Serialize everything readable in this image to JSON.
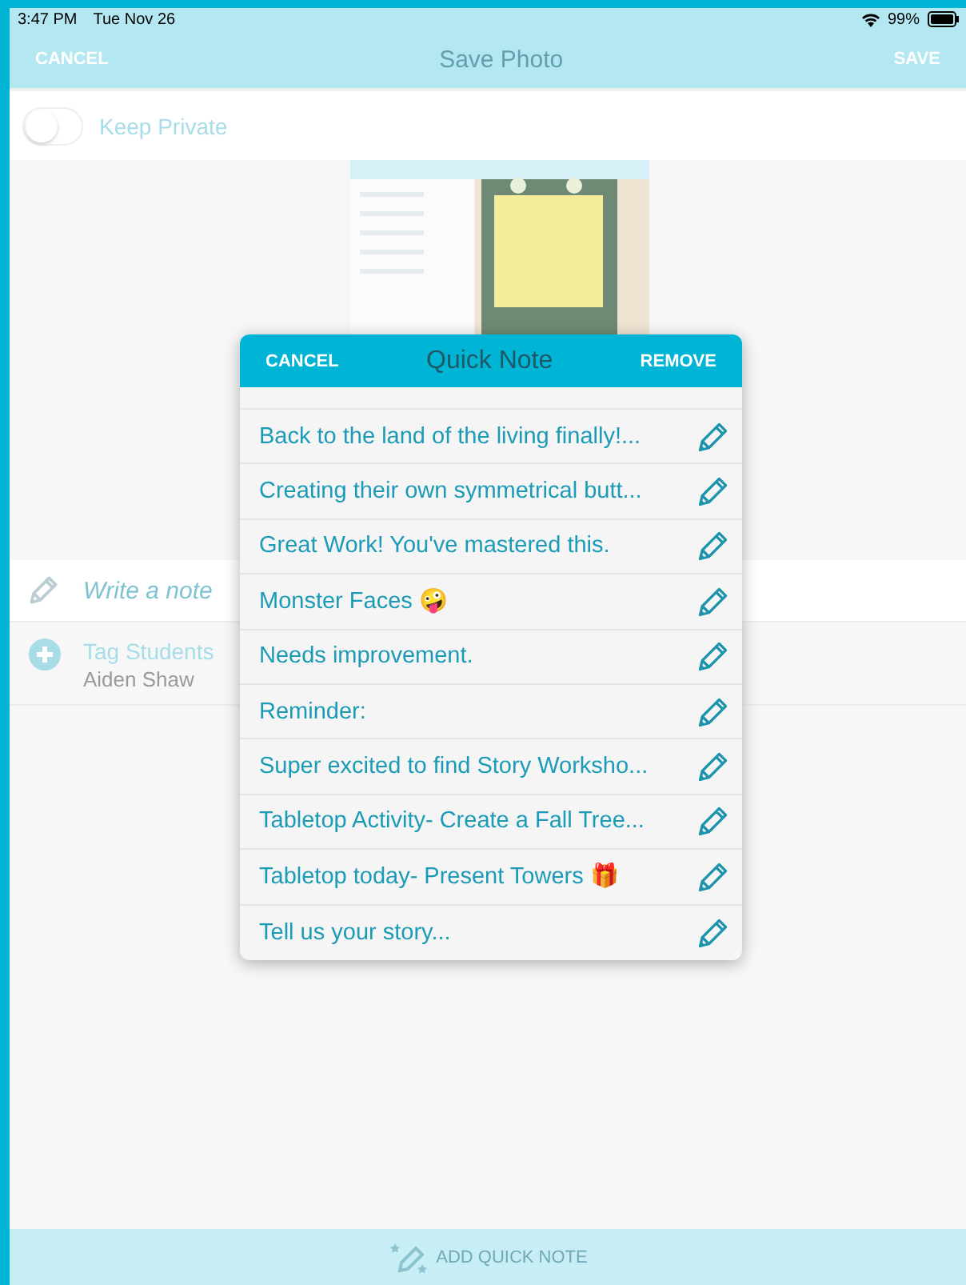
{
  "status_bar": {
    "time": "3:47 PM",
    "date": "Tue Nov 26",
    "battery": "99%"
  },
  "nav_bar": {
    "left": "CANCEL",
    "title": "Save Photo",
    "right": "SAVE"
  },
  "keep_private": {
    "label": "Keep Private",
    "on": false
  },
  "note_field": {
    "placeholder": "Write a note"
  },
  "tag_students": {
    "label": "Tag Students",
    "names": "Aiden Shaw"
  },
  "bottom_bar": {
    "label": "ADD QUICK NOTE"
  },
  "quick_note": {
    "title": "Quick Note",
    "cancel": "CANCEL",
    "remove": "REMOVE",
    "notes": [
      {
        "text": "Back to the land of the living finally!..."
      },
      {
        "text": "Creating their own symmetrical butt..."
      },
      {
        "text": "Great Work! You've mastered this."
      },
      {
        "text": "Monster Faces 🤪"
      },
      {
        "text": "Needs improvement."
      },
      {
        "text": "Reminder:"
      },
      {
        "text": "Super excited to find Story Worksho..."
      },
      {
        "text": "Tabletop Activity- Create a Fall Tree..."
      },
      {
        "text": "Tabletop today- Present Towers 🎁"
      },
      {
        "text": "Tell us your story..."
      }
    ]
  }
}
